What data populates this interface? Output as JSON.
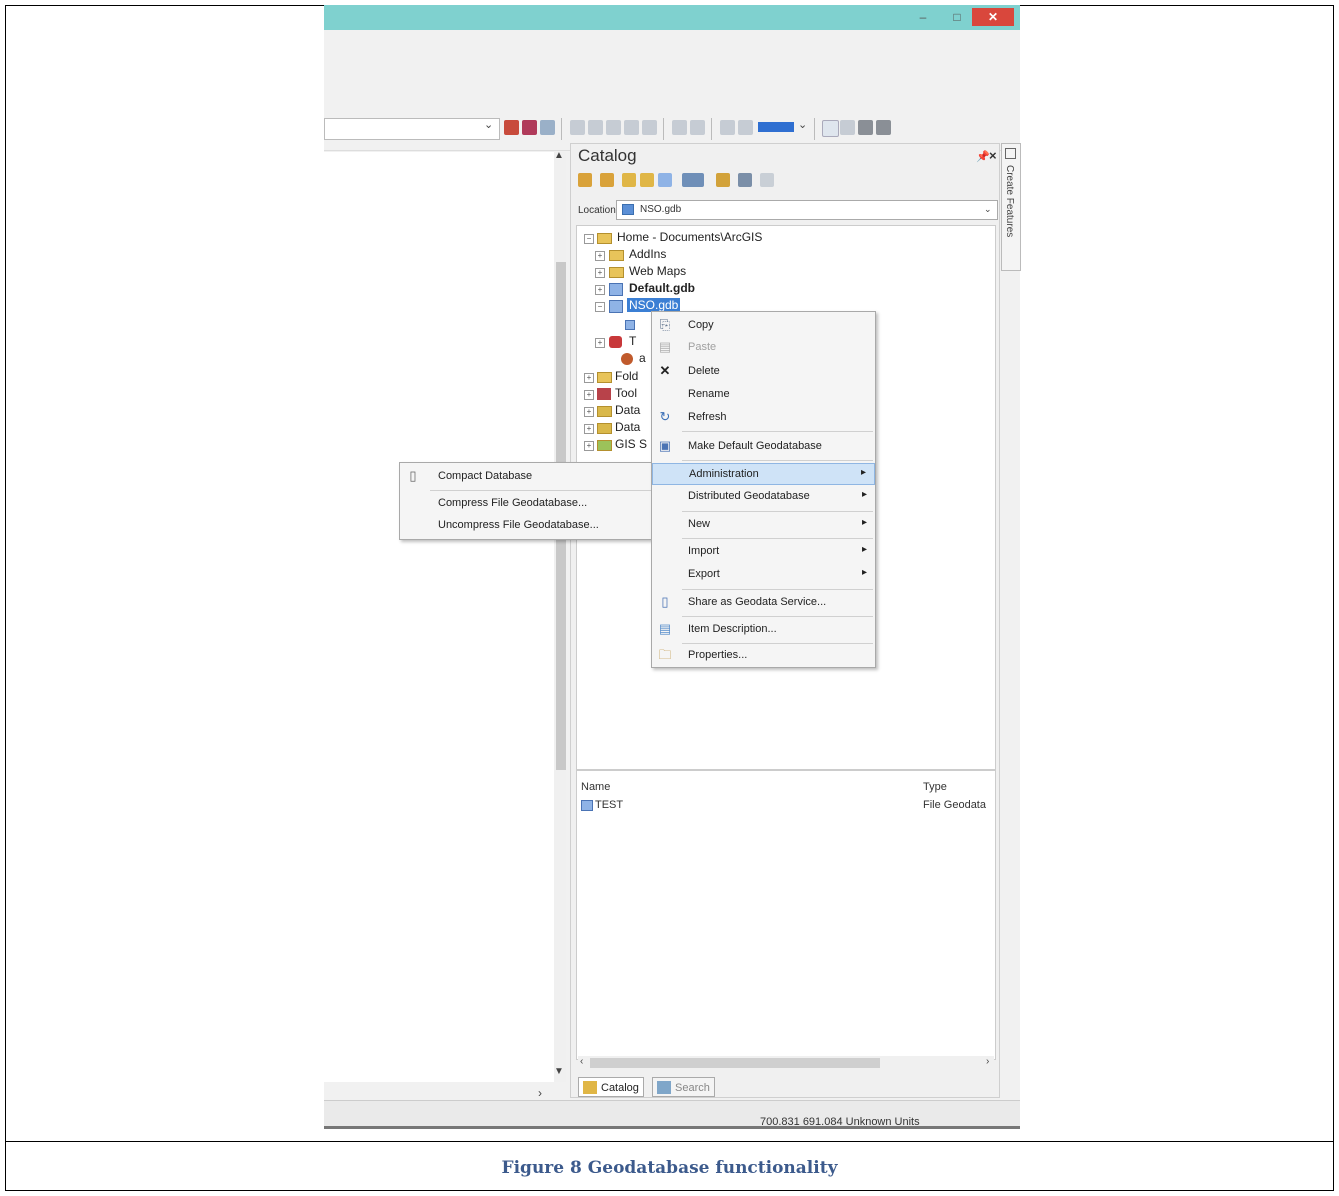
{
  "caption": "Figure 8 Geodatabase functionality",
  "window": {
    "minimize": "–",
    "maximize": "□",
    "close": "✕"
  },
  "catalog": {
    "title": "Catalog",
    "pin": "ᵖ",
    "close": "×",
    "location_label": "Location:",
    "location_value": "NSO.gdb",
    "tree": {
      "home": "Home - Documents\\ArcGIS",
      "addins": "AddIns",
      "webmaps": "Web Maps",
      "default_gdb": "Default.gdb",
      "nso_gdb": "NSO.gdb",
      "t_partial": "T",
      "a_partial": "a",
      "folder_partial": "Fold",
      "tool_partial": "Tool",
      "data1_partial": "Data",
      "data2_partial": "Data",
      "gis_partial": "GIS S"
    },
    "list": {
      "col_name": "Name",
      "col_type": "Type",
      "row_name": "TEST",
      "row_type": "File Geodata"
    },
    "tabs": {
      "catalog": "Catalog",
      "search": "Search"
    },
    "side_tab": "Create Features"
  },
  "context_menu": {
    "copy": "Copy",
    "paste": "Paste",
    "delete": "Delete",
    "rename": "Rename",
    "refresh": "Refresh",
    "make_default": "Make Default Geodatabase",
    "administration": "Administration",
    "distributed": "Distributed Geodatabase",
    "new": "New",
    "import": "Import",
    "export": "Export",
    "share": "Share as Geodata Service...",
    "item_description": "Item Description...",
    "properties": "Properties..."
  },
  "submenu": {
    "compact": "Compact Database",
    "compress": "Compress File Geodatabase...",
    "uncompress": "Uncompress File Geodatabase..."
  },
  "status": {
    "coordinates": "700.831  691.084 Unknown Units"
  }
}
